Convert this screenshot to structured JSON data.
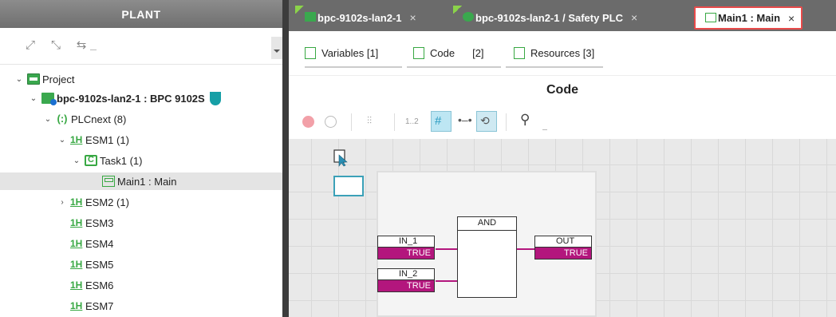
{
  "plant": {
    "title": "PLANT",
    "tree": [
      {
        "label": "Project",
        "bold": false
      },
      {
        "label": "bpc-9102s-lan2-1 : BPC 9102S",
        "bold": true
      },
      {
        "label": "PLCnext (8)",
        "bold": false
      },
      {
        "label": "ESM1 (1)",
        "bold": false
      },
      {
        "label": "Task1 (1)",
        "bold": false
      },
      {
        "label": "Main1 : Main",
        "bold": false,
        "selected": true
      },
      {
        "label": "ESM2 (1)",
        "bold": false
      },
      {
        "label": "ESM3",
        "bold": false
      },
      {
        "label": "ESM4",
        "bold": false
      },
      {
        "label": "ESM5",
        "bold": false
      },
      {
        "label": "ESM6",
        "bold": false
      },
      {
        "label": "ESM7",
        "bold": false
      }
    ]
  },
  "tabs": [
    {
      "label": "bpc-9102s-lan2-1",
      "close": "×"
    },
    {
      "label": "bpc-9102s-lan2-1 / Safety PLC",
      "close": "×"
    },
    {
      "label": "Main1 : Main",
      "close": "×",
      "active": true
    }
  ],
  "subtabs": {
    "variables": "Variables [1]",
    "code": "Code",
    "code_count": "[2]",
    "resources": "Resources [3]"
  },
  "editor": {
    "title": "Code",
    "tool_label_12": "1..2"
  },
  "diagram": {
    "in1": {
      "name": "IN_1",
      "value": "TRUE"
    },
    "in2": {
      "name": "IN_2",
      "value": "TRUE"
    },
    "block": {
      "name": "AND"
    },
    "out": {
      "name": "OUT",
      "value": "TRUE"
    }
  },
  "colors": {
    "accent_green": "#38a843",
    "signal_true": "#b3167d",
    "active_tab_border": "#e84a4a"
  }
}
